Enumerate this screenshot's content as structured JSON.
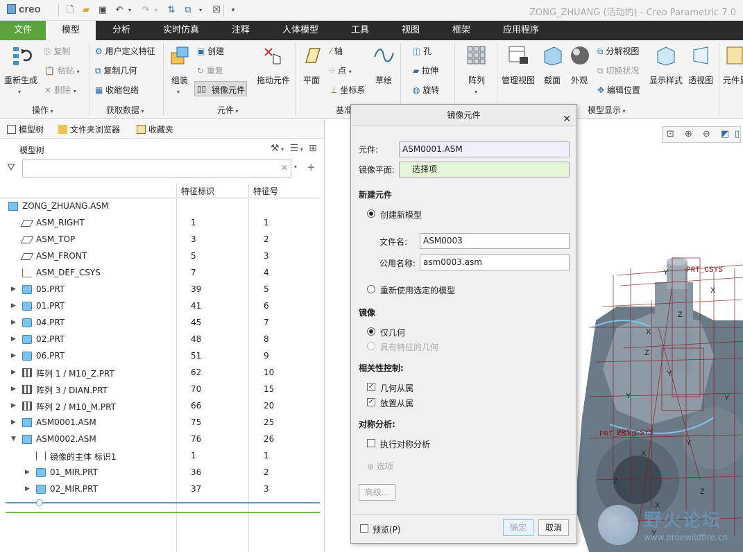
{
  "app": {
    "logo": "creo",
    "window_title": "ZONG_ZHUANG (活动的) - Creo Parametric 7.0"
  },
  "tabs": [
    {
      "label": "文件"
    },
    {
      "label": "模型"
    },
    {
      "label": "分析"
    },
    {
      "label": "实时仿真"
    },
    {
      "label": "注释"
    },
    {
      "label": "人体模型"
    },
    {
      "label": "工具"
    },
    {
      "label": "视图"
    },
    {
      "label": "框架"
    },
    {
      "label": "应用程序"
    }
  ],
  "ribbon": {
    "operations": {
      "regenerate": "重新生成",
      "copy": "复制",
      "paste": "粘贴",
      "delete": "删除",
      "group": "操作"
    },
    "get_data": {
      "udf": "用户定义特征",
      "copy_geom": "复制几何",
      "shrinkwrap": "收缩包络",
      "group": "获取数据"
    },
    "component": {
      "assemble": "组装",
      "create": "创建",
      "repeat": "重复",
      "mirror": "镜像元件",
      "drag": "拖动元件",
      "group": "元件"
    },
    "datum": {
      "plane": "平面",
      "axis": "轴",
      "point": "点",
      "csys": "坐标系",
      "sketch": "草绘",
      "group": "基准"
    },
    "cut_surface": {
      "hole": "孔",
      "extrude": "拉伸",
      "revolve": "旋转"
    },
    "pattern": {
      "label": "阵列"
    },
    "model_display": {
      "manage_views": "管理视图",
      "section": "截面",
      "appearance": "外观",
      "explode": "分解视图",
      "toggle_status": "切换状况",
      "edit_position": "编辑位置",
      "display_style": "显示样式",
      "perspective": "透视图",
      "component_display": "元件显",
      "group": "模型显示"
    }
  },
  "left_panel": {
    "tabs": [
      {
        "label": "模型树"
      },
      {
        "label": "文件夹浏览器"
      },
      {
        "label": "收藏夹"
      }
    ],
    "tree_header": "模型树",
    "filter_placeholder": "",
    "columns": [
      "特征标识",
      "特征号"
    ],
    "rows": [
      {
        "name": "ZONG_ZHUANG.ASM",
        "id": "",
        "num": "",
        "type": "asm",
        "indent": 0,
        "expand": ""
      },
      {
        "name": "ASM_RIGHT",
        "id": "1",
        "num": "1",
        "type": "plane",
        "indent": 1,
        "expand": ""
      },
      {
        "name": "ASM_TOP",
        "id": "3",
        "num": "2",
        "type": "plane",
        "indent": 1,
        "expand": ""
      },
      {
        "name": "ASM_FRONT",
        "id": "5",
        "num": "3",
        "type": "plane",
        "indent": 1,
        "expand": ""
      },
      {
        "name": "ASM_DEF_CSYS",
        "id": "7",
        "num": "4",
        "type": "csys",
        "indent": 1,
        "expand": ""
      },
      {
        "name": "05.PRT",
        "id": "39",
        "num": "5",
        "type": "prt",
        "indent": 1,
        "expand": "▶"
      },
      {
        "name": "01.PRT",
        "id": "41",
        "num": "6",
        "type": "prt",
        "indent": 1,
        "expand": "▶"
      },
      {
        "name": "04.PRT",
        "id": "45",
        "num": "7",
        "type": "prt",
        "indent": 1,
        "expand": "▶"
      },
      {
        "name": "02.PRT",
        "id": "48",
        "num": "8",
        "type": "prt",
        "indent": 1,
        "expand": "▶"
      },
      {
        "name": "06.PRT",
        "id": "51",
        "num": "9",
        "type": "prt",
        "indent": 1,
        "expand": "▶"
      },
      {
        "name": "阵列 1 / M10_Z.PRT",
        "id": "62",
        "num": "10",
        "type": "pattern",
        "indent": 1,
        "expand": "▶"
      },
      {
        "name": "阵列 3 / DIAN.PRT",
        "id": "70",
        "num": "15",
        "type": "pattern",
        "indent": 1,
        "expand": "▶"
      },
      {
        "name": "阵列 2 / M10_M.PRT",
        "id": "66",
        "num": "20",
        "type": "pattern",
        "indent": 1,
        "expand": "▶"
      },
      {
        "name": "ASM0001.ASM",
        "id": "75",
        "num": "25",
        "type": "asm",
        "indent": 1,
        "expand": "▶"
      },
      {
        "name": "ASM0002.ASM",
        "id": "76",
        "num": "26",
        "type": "asm",
        "indent": 1,
        "expand": "▼"
      },
      {
        "name": "镜像的主体 标识1",
        "id": "1",
        "num": "1",
        "type": "mirror",
        "indent": 2,
        "expand": ""
      },
      {
        "name": "01_MIR.PRT",
        "id": "36",
        "num": "2",
        "type": "prt",
        "indent": 2,
        "expand": "▶"
      },
      {
        "name": "02_MIR.PRT",
        "id": "37",
        "num": "3",
        "type": "prt",
        "indent": 2,
        "expand": "▶"
      }
    ]
  },
  "dialog": {
    "title": "镜像元件",
    "component_label": "元件:",
    "component_value": "ASM0001.ASM",
    "mirror_plane_label": "镜像平面:",
    "mirror_plane_value": "选择项",
    "new_component_header": "新建元件",
    "create_new_model": "创建新模型",
    "file_name_label": "文件名:",
    "file_name_value": "ASM0003",
    "common_name_label": "公用名称:",
    "common_name_value": "asm0003.asm",
    "reuse_model": "重新使用选定的模型",
    "mirror_header": "镜像",
    "geometry_only": "仅几何",
    "geometry_with_features": "具有特征的几何",
    "dependency_header": "相关性控制:",
    "geometry_dependent": "几何从属",
    "placement_dependent": "放置从属",
    "symmetry_header": "对称分析:",
    "run_symmetry": "执行对称分析",
    "options": "选项",
    "advanced": "高级...",
    "preview": "预览(P)",
    "ok": "确定",
    "cancel": "取消"
  },
  "graphics": {
    "watermark": "野火论坛",
    "watermark_url": "www.proewildfire.cn",
    "labels": [
      "Y",
      "X",
      "Z",
      "PRT_CSYS"
    ]
  },
  "colors": {
    "file_tab": "#5aa43a",
    "tab_bar": "#2b2b2b",
    "accent_blue": "#5a9fd4",
    "plane_field": "#e4f5d8",
    "component_field": "#f1eefc"
  }
}
